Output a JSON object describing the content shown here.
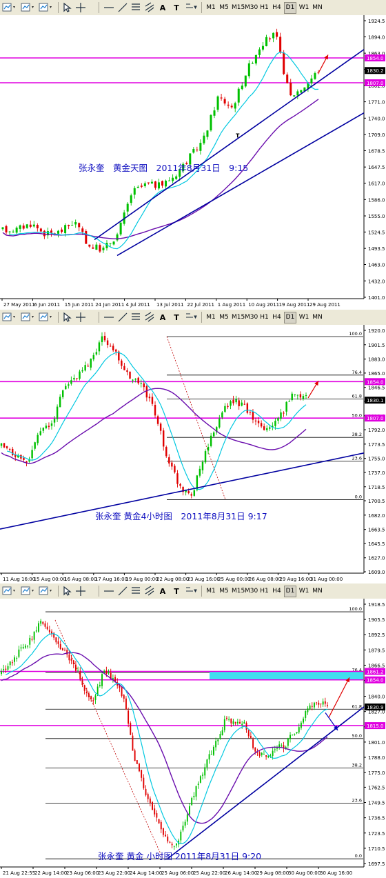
{
  "toolbar": {
    "timeframes": [
      "M1",
      "M5",
      "M15",
      "M30",
      "H1",
      "H4",
      "D1",
      "W1",
      "MN"
    ],
    "tools": {
      "text_tool": "A",
      "text_label_tool": "T"
    }
  },
  "colors": {
    "bull": "#00c000",
    "bear": "#e00000",
    "ma_fast": "#00c8e0",
    "ma_slow": "#6a0dad",
    "level": "#e000e0",
    "channel": "#0000a0",
    "fib": "#000000",
    "target_zone": "#40e0f0",
    "arrow_red": "#e00000",
    "arrow_blue": "#0000c0"
  },
  "chart_data": [
    {
      "type": "candlestick",
      "caption": "张永奎　黄金天图　2011年8月31日　9:15",
      "y_ticks": [
        "1924.5",
        "1894.0",
        "1863.0",
        "1832.5",
        "1802.0",
        "1771.0",
        "1740.0",
        "1709.0",
        "1678.5",
        "1647.5",
        "1617.0",
        "1586.0",
        "1555.0",
        "1524.5",
        "1493.5",
        "1463.0",
        "1432.0",
        "1401.0"
      ],
      "x_ticks": [
        "27 May 2011",
        "6 Jun 2011",
        "15 Jun 2011",
        "24 Jun 2011",
        "4 Jul 2011",
        "13 Jul 2011",
        "22 Jul 2011",
        "1 Aug 2011",
        "10 Aug 2011",
        "19 Aug 2011",
        "29 Aug 2011"
      ],
      "ylim": [
        1401.0,
        1924.5
      ],
      "price_tags": [
        {
          "label": "1854.0",
          "value": 1854.0,
          "style": "level"
        },
        {
          "label": "1830.2",
          "value": 1830.2,
          "style": "price"
        },
        {
          "label": "1807.0",
          "value": 1807.0,
          "style": "level"
        }
      ],
      "levels": [
        1854.0,
        1807.0
      ],
      "marker_letter": "T"
    },
    {
      "type": "candlestick",
      "caption": "张永奎 黄金4小时图　2011年8月31日 9:17",
      "y_ticks": [
        "1920.0",
        "1901.5",
        "1883.0",
        "1865.0",
        "1846.5",
        "1828.5",
        "1810.0",
        "1792.0",
        "1773.5",
        "1755.0",
        "1737.0",
        "1718.5",
        "1700.5",
        "1682.0",
        "1663.5",
        "1645.5",
        "1627.0",
        "1609.0"
      ],
      "x_ticks": [
        "11 Aug 16:00",
        "15 Aug 00:00",
        "16 Aug 08:00",
        "17 Aug 16:00",
        "19 Aug 00:00",
        "22 Aug 08:00",
        "23 Aug 16:00",
        "25 Aug 00:00",
        "26 Aug 08:00",
        "29 Aug 16:00",
        "31 Aug 00:00"
      ],
      "ylim": [
        1609.0,
        1920.0
      ],
      "fib_levels": [
        {
          "label": "100.0",
          "value": 1912.0
        },
        {
          "label": "76.4",
          "value": 1862.4
        },
        {
          "label": "61.8",
          "value": 1831.7
        },
        {
          "label": "50.0",
          "value": 1806.9
        },
        {
          "label": "38.2",
          "value": 1782.1
        },
        {
          "label": "23.6",
          "value": 1751.4
        },
        {
          "label": "0.0",
          "value": 1701.8
        }
      ],
      "price_tags": [
        {
          "label": "1854.0",
          "value": 1854.0,
          "style": "level"
        },
        {
          "label": "1830.1",
          "value": 1830.1,
          "style": "price"
        },
        {
          "label": "1807.0",
          "value": 1807.0,
          "style": "level"
        }
      ],
      "levels": [
        1854.0,
        1807.0
      ]
    },
    {
      "type": "candlestick",
      "caption": "张永奎 黄金 小时图 2011年8月31日 9:20",
      "y_ticks": [
        "1918.5",
        "1905.5",
        "1892.5",
        "1879.5",
        "1866.5",
        "1853.5",
        "1840.0",
        "1827.0",
        "1814.0",
        "1801.0",
        "1788.0",
        "1775.0",
        "1762.5",
        "1749.5",
        "1736.5",
        "1723.5",
        "1710.5",
        "1697.5"
      ],
      "x_ticks": [
        "21 Aug 22:55",
        "22 Aug 14:00",
        "23 Aug 06:00",
        "23 Aug 22:00",
        "24 Aug 14:00",
        "25 Aug 06:00",
        "25 Aug 22:00",
        "26 Aug 14:00",
        "29 Aug 08:00",
        "30 Aug 00:00",
        "30 Aug 16:00"
      ],
      "ylim": [
        1697.5,
        1918.5
      ],
      "fib_levels": [
        {
          "label": "100.0",
          "value": 1912.0
        },
        {
          "label": "76.4",
          "value": 1860.0
        },
        {
          "label": "61.8",
          "value": 1829.0
        },
        {
          "label": "50.0",
          "value": 1804.0
        },
        {
          "label": "38.2",
          "value": 1779.0
        },
        {
          "label": "23.6",
          "value": 1749.0
        },
        {
          "label": "0.0",
          "value": 1701.5
        }
      ],
      "price_tags": [
        {
          "label": "1861.2",
          "value": 1861.2,
          "style": "level"
        },
        {
          "label": "1854.0",
          "value": 1854.0,
          "style": "level"
        },
        {
          "label": "1830.9",
          "value": 1830.9,
          "style": "price"
        },
        {
          "label": "1815.0",
          "value": 1815.0,
          "style": "level"
        }
      ],
      "levels": [
        1861.2,
        1854.0,
        1815.0
      ]
    }
  ]
}
